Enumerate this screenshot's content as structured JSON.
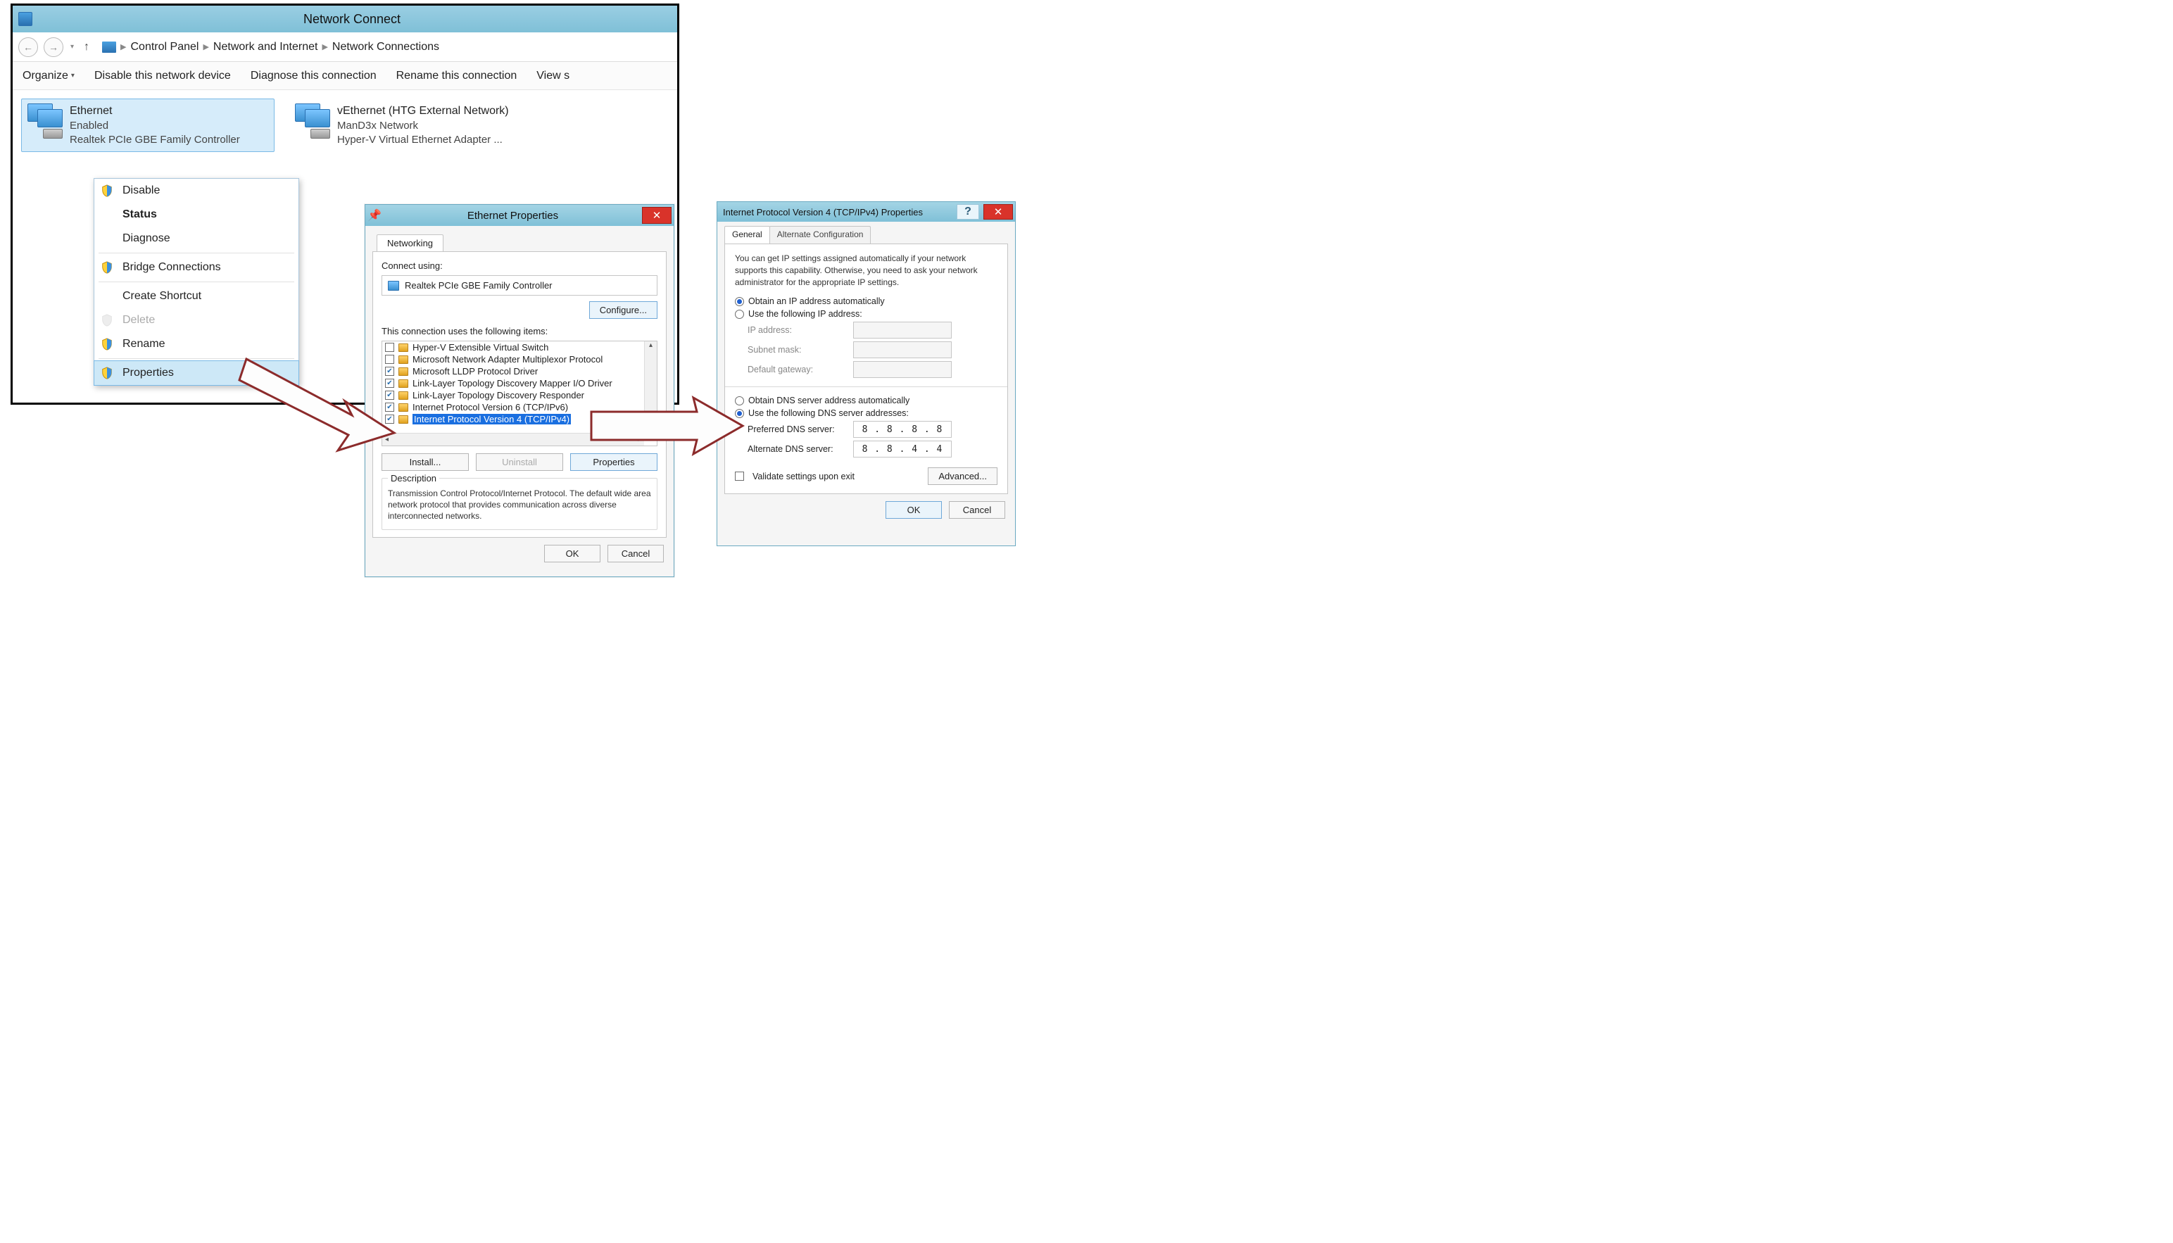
{
  "win1": {
    "title": "Network Connect",
    "breadcrumb": [
      "Control Panel",
      "Network and Internet",
      "Network Connections"
    ],
    "toolbar": {
      "organize": "Organize",
      "disable": "Disable this network device",
      "diagnose": "Diagnose this connection",
      "rename": "Rename this connection",
      "view": "View s"
    },
    "adapters": [
      {
        "name": "Ethernet",
        "status": "Enabled",
        "device": "Realtek PCIe GBE Family Controller"
      },
      {
        "name": "vEthernet (HTG External Network)",
        "status": "ManD3x Network",
        "device": "Hyper-V Virtual Ethernet Adapter ..."
      }
    ],
    "ctx": {
      "disable": "Disable",
      "status": "Status",
      "diagnose": "Diagnose",
      "bridge": "Bridge Connections",
      "shortcut": "Create Shortcut",
      "delete": "Delete",
      "rename": "Rename",
      "properties": "Properties"
    }
  },
  "win2": {
    "title": "Ethernet Properties",
    "tab": "Networking",
    "connect_using_label": "Connect using:",
    "adapter": "Realtek PCIe GBE Family Controller",
    "configure_btn": "Configure...",
    "items_label": "This connection uses the following items:",
    "items": [
      {
        "checked": false,
        "label": "Hyper-V Extensible Virtual Switch"
      },
      {
        "checked": false,
        "label": "Microsoft Network Adapter Multiplexor Protocol"
      },
      {
        "checked": true,
        "label": "Microsoft LLDP Protocol Driver"
      },
      {
        "checked": true,
        "label": "Link-Layer Topology Discovery Mapper I/O Driver"
      },
      {
        "checked": true,
        "label": "Link-Layer Topology Discovery Responder"
      },
      {
        "checked": true,
        "label": "Internet Protocol Version 6 (TCP/IPv6)"
      },
      {
        "checked": true,
        "label": "Internet Protocol Version 4 (TCP/IPv4)",
        "selected": true
      }
    ],
    "install_btn": "Install...",
    "uninstall_btn": "Uninstall",
    "properties_btn": "Properties",
    "desc_label": "Description",
    "desc_text": "Transmission Control Protocol/Internet Protocol. The default wide area network protocol that provides communication across diverse interconnected networks.",
    "ok_btn": "OK",
    "cancel_btn": "Cancel"
  },
  "win3": {
    "title": "Internet Protocol Version 4 (TCP/IPv4) Properties",
    "tabs": {
      "general": "General",
      "alt": "Alternate Configuration"
    },
    "info": "You can get IP settings assigned automatically if your network supports this capability. Otherwise, you need to ask your network administrator for the appropriate IP settings.",
    "ip": {
      "auto_label": "Obtain an IP address automatically",
      "manual_label": "Use the following IP address:",
      "ip_label": "IP address:",
      "mask_label": "Subnet mask:",
      "gw_label": "Default gateway:"
    },
    "dns": {
      "auto_label": "Obtain DNS server address automatically",
      "manual_label": "Use the following DNS server addresses:",
      "pref_label": "Preferred DNS server:",
      "alt_label": "Alternate DNS server:",
      "pref_value": "8 . 8 . 8 . 8",
      "alt_value": "8 . 8 . 4 . 4"
    },
    "validate_label": "Validate settings upon exit",
    "advanced_btn": "Advanced...",
    "ok_btn": "OK",
    "cancel_btn": "Cancel"
  }
}
